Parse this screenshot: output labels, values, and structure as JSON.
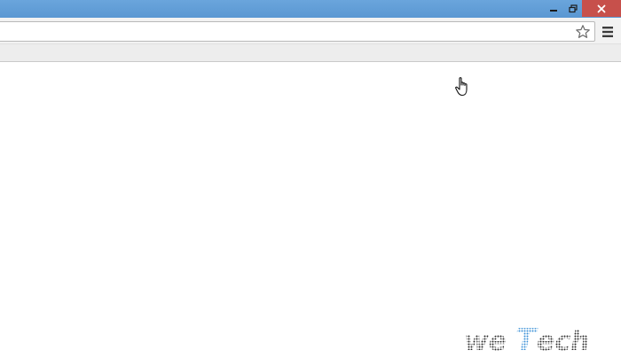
{
  "window": {
    "title_bar_color": "#5b9bd5",
    "close_button_color": "#c7504b",
    "controls": {
      "minimize_icon": "minimize-icon",
      "restore_icon": "restore-icon",
      "close_icon": "close-icon"
    }
  },
  "toolbar": {
    "address_value": "",
    "bookmark_icon": "star-icon",
    "menu_icon": "hamburger-menu-icon"
  },
  "page": {
    "background": "#ffffff",
    "cursor_icon": "hand-pointer-icon"
  },
  "watermark": {
    "text": "weTech",
    "colors": [
      "#1a1a1a",
      "#3a8fd6"
    ]
  }
}
